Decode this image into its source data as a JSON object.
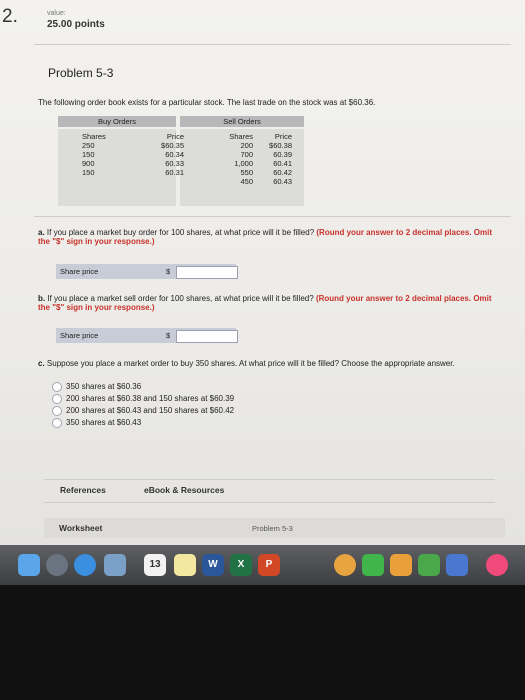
{
  "header": {
    "question_number": "2.",
    "value_label": "value:",
    "points": "25.00 points"
  },
  "problem": {
    "title": "Problem 5-3",
    "intro": "The following order book exists for a particular stock. The last trade on the stock was at $60.36."
  },
  "order_book": {
    "buy_header": "Buy Orders",
    "sell_header": "Sell Orders",
    "buy_columns": [
      "Shares",
      "Price"
    ],
    "sell_columns": [
      "Shares",
      "Price"
    ],
    "buy_rows": [
      [
        "250",
        "$60.35"
      ],
      [
        "150",
        "60.34"
      ],
      [
        "900",
        "60.33"
      ],
      [
        "150",
        "60.31"
      ]
    ],
    "sell_rows": [
      [
        "200",
        "$60.38"
      ],
      [
        "700",
        "60.39"
      ],
      [
        "1,000",
        "60.41"
      ],
      [
        "550",
        "60.42"
      ],
      [
        "450",
        "60.43"
      ]
    ]
  },
  "question_a": {
    "letter": "a.",
    "text": "If you place a market buy order for 100 shares, at what price will it be filled?",
    "instruction": "(Round your answer to 2 decimal places. Omit the \"$\" sign in your response.)",
    "answer_label": "Share price",
    "currency": "$",
    "answer_value": ""
  },
  "question_b": {
    "letter": "b.",
    "text": "If you place a market sell order for 100 shares, at what price will it be filled?",
    "instruction": "(Round your answer to 2 decimal places. Omit the \"$\" sign in your response.)",
    "answer_label": "Share price",
    "currency": "$",
    "answer_value": ""
  },
  "question_c": {
    "letter": "c.",
    "text": "Suppose you place a market order to buy 350 shares. At what price will it be filled? Choose the appropriate answer.",
    "options": [
      "350 shares at $60.36",
      "200 shares at $60.38 and 150 shares at $60.39",
      "200 shares at $60.43 and 150 shares at $60.42",
      "350 shares at $60.43"
    ]
  },
  "resources": {
    "references": "References",
    "ebook": "eBook & Resources"
  },
  "footer": {
    "worksheet": "Worksheet",
    "problem_name": "Problem 5-3"
  },
  "dock": {
    "calendar_day": "13",
    "icons": [
      "finder-icon",
      "launchpad-icon",
      "safari-icon",
      "preview-icon",
      "calendar-icon",
      "notes-icon",
      "word-icon",
      "excel-icon",
      "powerpoint-icon",
      "photos-icon",
      "facetime-icon",
      "pages-icon",
      "numbers-icon",
      "keynote-icon",
      "itunes-icon"
    ]
  }
}
